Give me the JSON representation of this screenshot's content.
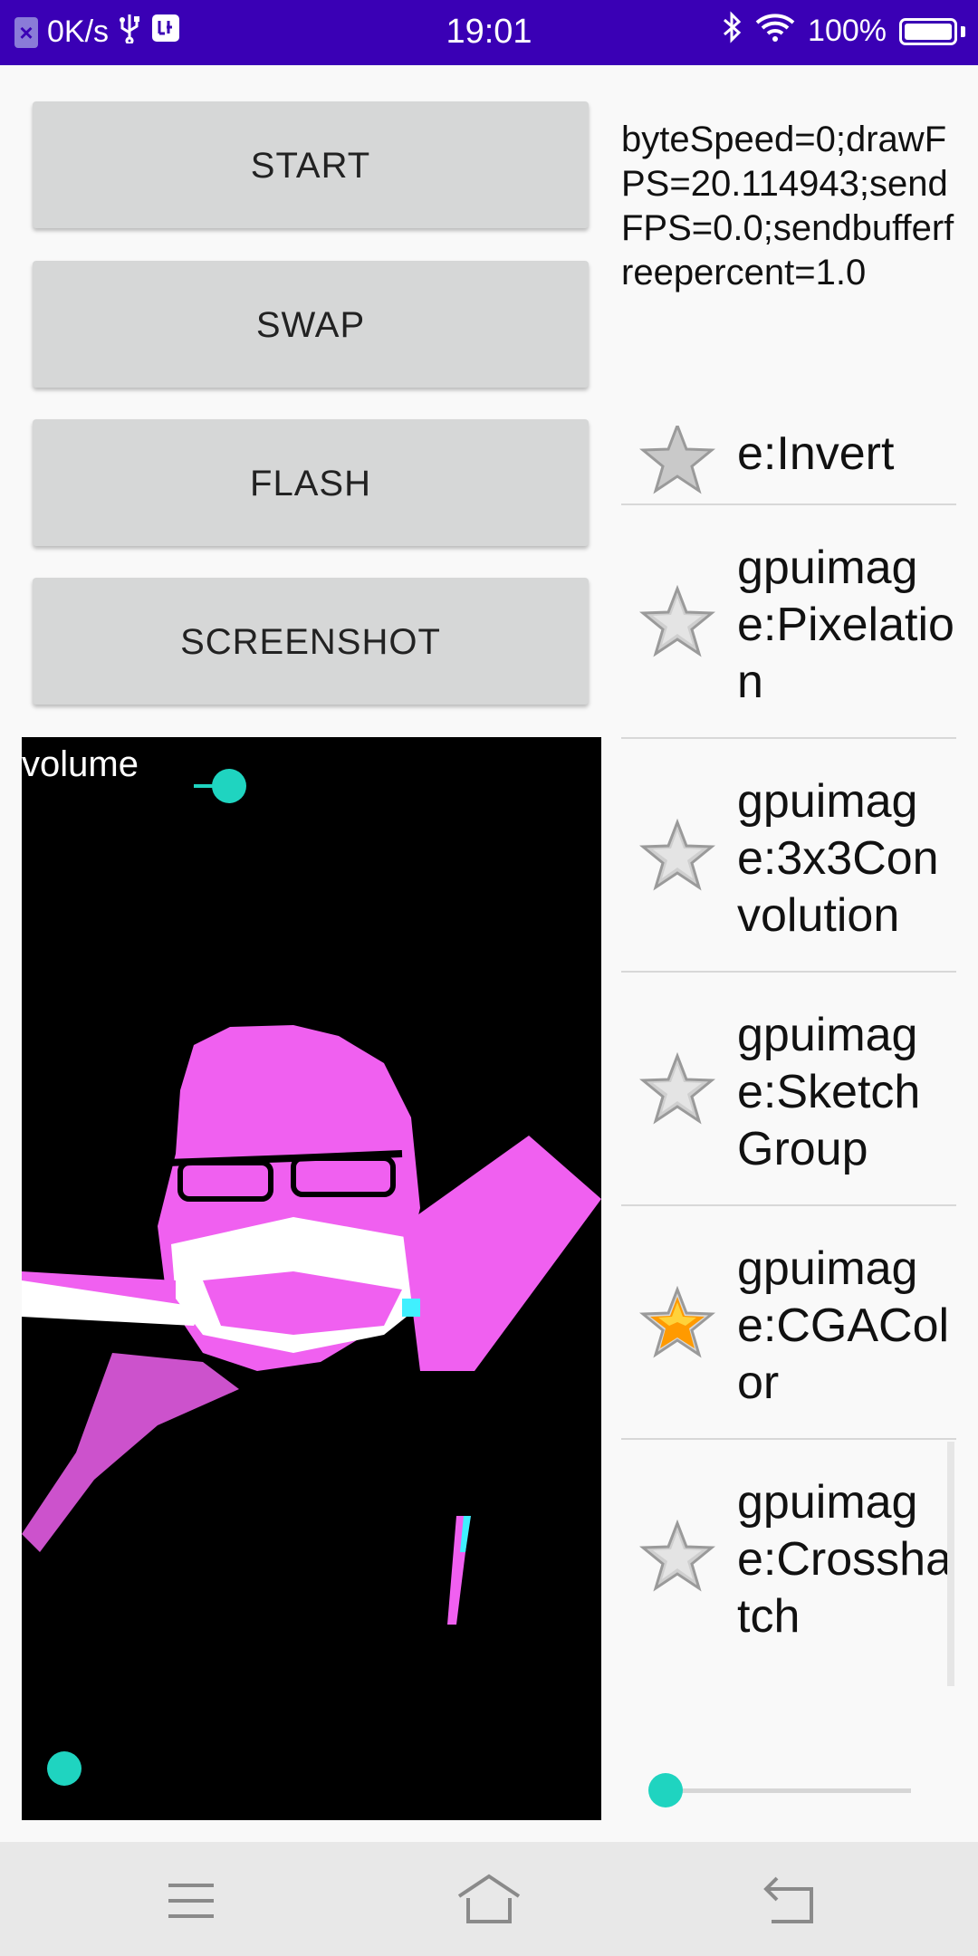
{
  "status_bar": {
    "speed": "0K/s",
    "time": "19:01",
    "battery": "100%"
  },
  "buttons": {
    "start": "START",
    "swap": "SWAP",
    "flash": "FLASH",
    "screenshot": "SCREENSHOT"
  },
  "info_text": "byteSpeed=0;drawFPS=20.114943;sendFPS=0.0;sendbufferfreepercent=1.0",
  "filter_list": {
    "partial_top_label": "e:Invert",
    "items": [
      {
        "label": "gpuimage:Pixelation",
        "favorite": false
      },
      {
        "label": "gpuimage:3x3Convolution",
        "favorite": false
      },
      {
        "label": "gpuimage:SketchGroup",
        "favorite": false
      },
      {
        "label": "gpuimage:CGAColor",
        "favorite": true
      },
      {
        "label": "gpuimage:Crosshatch",
        "favorite": false
      }
    ]
  },
  "video": {
    "volume_label": "volume"
  },
  "colors": {
    "status_bar": "#3a00b5",
    "accent": "#1fd4c0",
    "button": "#d6d7d7",
    "preview_magenta": "#f060f0"
  },
  "icons": {
    "star_off": "star-outline-icon",
    "star_on": "star-filled-icon",
    "nav": [
      "menu-icon",
      "home-icon",
      "back-icon"
    ]
  }
}
